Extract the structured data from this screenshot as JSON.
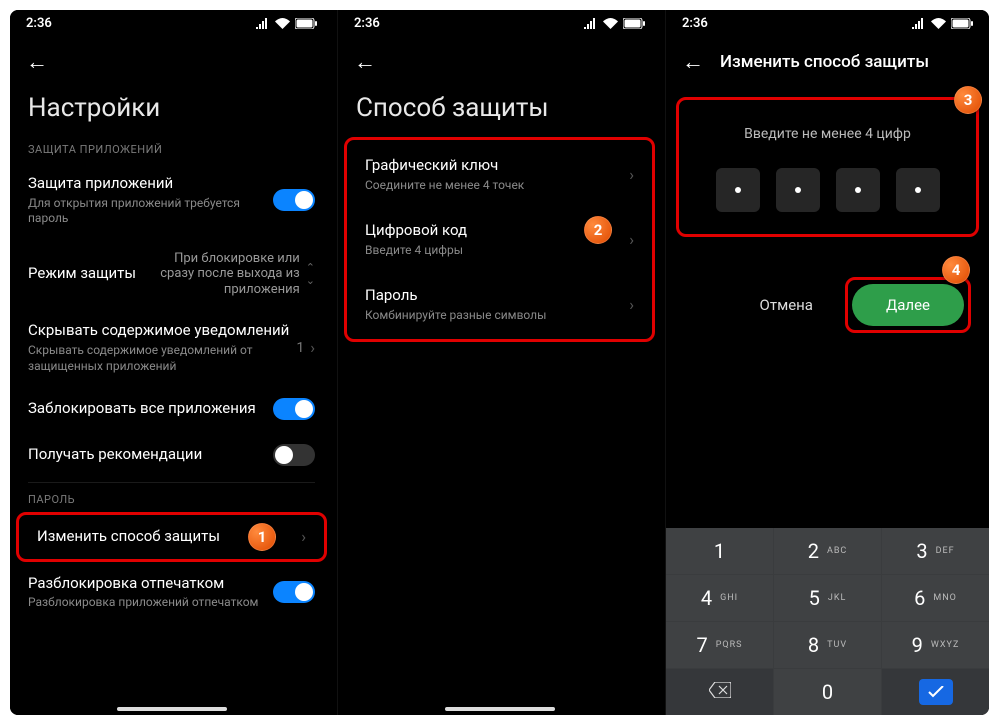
{
  "statusbar": {
    "time": "2:36"
  },
  "screen1": {
    "title": "Настройки",
    "section1": "ЗАЩИТА ПРИЛОЖЕНИЙ",
    "app_lock": {
      "title": "Защита приложений",
      "sub": "Для открытия приложений требуется пароль"
    },
    "lock_mode": {
      "title": "Режим защиты",
      "value": "При блокировке или сразу после выхода из приложения"
    },
    "hide_notif": {
      "title": "Скрывать содержимое уведомлений",
      "sub": "Скрывать содержимое уведомлений от защищенных приложений",
      "count": "1"
    },
    "lock_all": {
      "title": "Заблокировать все приложения"
    },
    "recommendations": {
      "title": "Получать рекомендации"
    },
    "section2": "ПАРОЛЬ",
    "change_method": {
      "title": "Изменить способ защиты"
    },
    "fingerprint": {
      "title": "Разблокировка отпечатком",
      "sub": "Разблокировка приложений отпечатком"
    }
  },
  "screen2": {
    "title": "Способ защиты",
    "pattern": {
      "title": "Графический ключ",
      "sub": "Соедините не менее 4 точек"
    },
    "pin": {
      "title": "Цифровой код",
      "sub": "Введите 4 цифры"
    },
    "password": {
      "title": "Пароль",
      "sub": "Комбинируйте разные символы"
    }
  },
  "screen3": {
    "header": "Изменить способ защиты",
    "prompt": "Введите не менее 4 цифр",
    "cancel": "Отмена",
    "next": "Далее",
    "keys": {
      "1": {
        "n": "1",
        "l": ""
      },
      "2": {
        "n": "2",
        "l": "ABC"
      },
      "3": {
        "n": "3",
        "l": "DEF"
      },
      "4": {
        "n": "4",
        "l": "GHI"
      },
      "5": {
        "n": "5",
        "l": "JKL"
      },
      "6": {
        "n": "6",
        "l": "MNO"
      },
      "7": {
        "n": "7",
        "l": "PQRS"
      },
      "8": {
        "n": "8",
        "l": "TUV"
      },
      "9": {
        "n": "9",
        "l": "WXYZ"
      },
      "0": {
        "n": "0",
        "l": ""
      }
    }
  },
  "badges": {
    "b1": "1",
    "b2": "2",
    "b3": "3",
    "b4": "4"
  }
}
